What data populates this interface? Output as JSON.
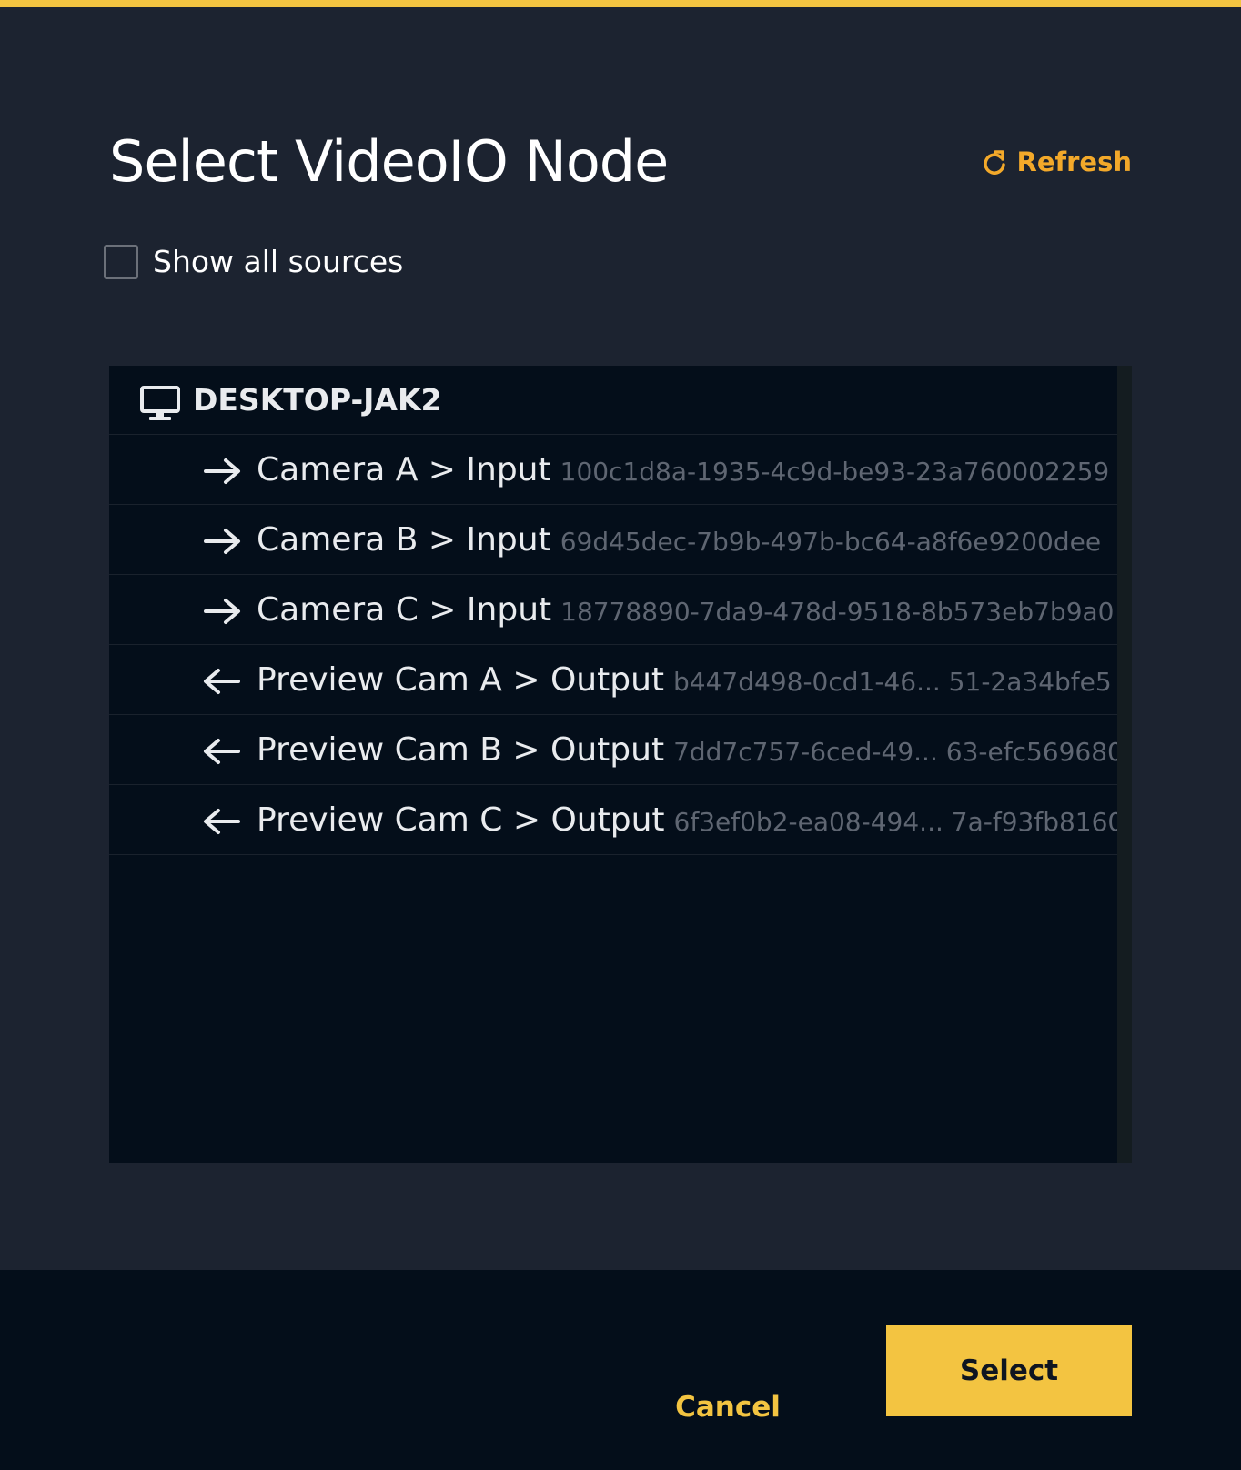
{
  "dialog": {
    "title": "Select VideoIO Node",
    "refresh_label": "Refresh",
    "show_all_sources_label": "Show all sources",
    "show_all_sources_checked": false
  },
  "tree": {
    "host": {
      "label": "DESKTOP-JAK2",
      "icon": "monitor-icon"
    },
    "items": [
      {
        "direction": "input",
        "icon": "arrow-right-icon",
        "name": "Camera A > Input",
        "id": "100c1d8a-1935-4c9d-be93-23a760002259"
      },
      {
        "direction": "input",
        "icon": "arrow-right-icon",
        "name": "Camera B > Input",
        "id": "69d45dec-7b9b-497b-bc64-a8f6e9200dee"
      },
      {
        "direction": "input",
        "icon": "arrow-right-icon",
        "name": "Camera C > Input",
        "id": "18778890-7da9-478d-9518-8b573eb7b9a0"
      },
      {
        "direction": "output",
        "icon": "arrow-left-icon",
        "name": "Preview Cam A > Output",
        "id": "b447d498-0cd1-46... 51-2a34bfe5"
      },
      {
        "direction": "output",
        "icon": "arrow-left-icon",
        "name": "Preview Cam B > Output",
        "id": "7dd7c757-6ced-49... 63-efc569680"
      },
      {
        "direction": "output",
        "icon": "arrow-left-icon",
        "name": "Preview Cam C > Output",
        "id": "6f3ef0b2-ea08-494... 7a-f93fb8160"
      }
    ]
  },
  "footer": {
    "cancel_label": "Cancel",
    "select_label": "Select"
  },
  "colors": {
    "accent": "#f3c441",
    "refresh": "#f3a92a",
    "dialog_bg": "#1c2330",
    "panel_bg": "#040e1a"
  }
}
